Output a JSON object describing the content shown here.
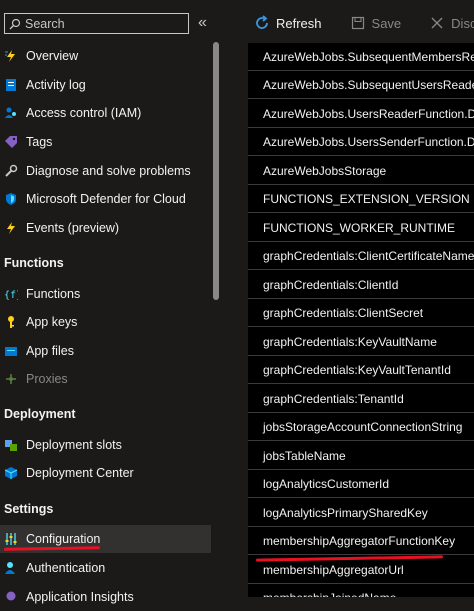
{
  "search": {
    "placeholder": "Search",
    "value": ""
  },
  "collapse_glyph": "«",
  "sidebar": {
    "items_top": [
      {
        "label": "Overview",
        "icon": "lightning-overview-icon"
      },
      {
        "label": "Activity log",
        "icon": "activity-log-icon"
      },
      {
        "label": "Access control (IAM)",
        "icon": "people-iam-icon"
      },
      {
        "label": "Tags",
        "icon": "tag-icon"
      },
      {
        "label": "Diagnose and solve problems",
        "icon": "wrench-icon"
      },
      {
        "label": "Microsoft Defender for Cloud",
        "icon": "shield-icon"
      },
      {
        "label": "Events (preview)",
        "icon": "lightning-icon"
      }
    ],
    "section_functions": "Functions",
    "items_functions": [
      {
        "label": "Functions",
        "icon": "function-icon"
      },
      {
        "label": "App keys",
        "icon": "key-icon"
      },
      {
        "label": "App files",
        "icon": "file-icon"
      },
      {
        "label": "Proxies",
        "icon": "proxy-icon",
        "disabled": true
      }
    ],
    "section_deployment": "Deployment",
    "items_deployment": [
      {
        "label": "Deployment slots",
        "icon": "slots-icon"
      },
      {
        "label": "Deployment Center",
        "icon": "cube-icon"
      }
    ],
    "section_settings": "Settings",
    "items_settings": [
      {
        "label": "Configuration",
        "icon": "sliders-icon",
        "active": true
      },
      {
        "label": "Authentication",
        "icon": "user-icon"
      },
      {
        "label": "Application Insights",
        "icon": "insights-icon"
      }
    ]
  },
  "toolbar": {
    "refresh_label": "Refresh",
    "save_label": "Save",
    "discard_label": "Discard"
  },
  "settings_rows": [
    "AzureWebJobs.SubsequentMembersReaderFunc",
    "AzureWebJobs.SubsequentUsersReaderFunctio",
    "AzureWebJobs.UsersReaderFunction.Disable",
    "AzureWebJobs.UsersSenderFunction.Disabled",
    "AzureWebJobsStorage",
    "FUNCTIONS_EXTENSION_VERSION",
    "FUNCTIONS_WORKER_RUNTIME",
    "graphCredentials:ClientCertificateName",
    "graphCredentials:ClientId",
    "graphCredentials:ClientSecret",
    "graphCredentials:KeyVaultName",
    "graphCredentials:KeyVaultTenantId",
    "graphCredentials:TenantId",
    "jobsStorageAccountConnectionString",
    "jobsTableName",
    "logAnalyticsCustomerId",
    "logAnalyticsPrimarySharedKey",
    "membershipAggregatorFunctionKey",
    "membershipAggregatorUrl",
    "membershipJoinedName"
  ],
  "colors": {
    "accent_blue": "#0078d4",
    "annotation_red": "#e81123",
    "background": "#1b1a19",
    "settings_background": "#000000"
  }
}
